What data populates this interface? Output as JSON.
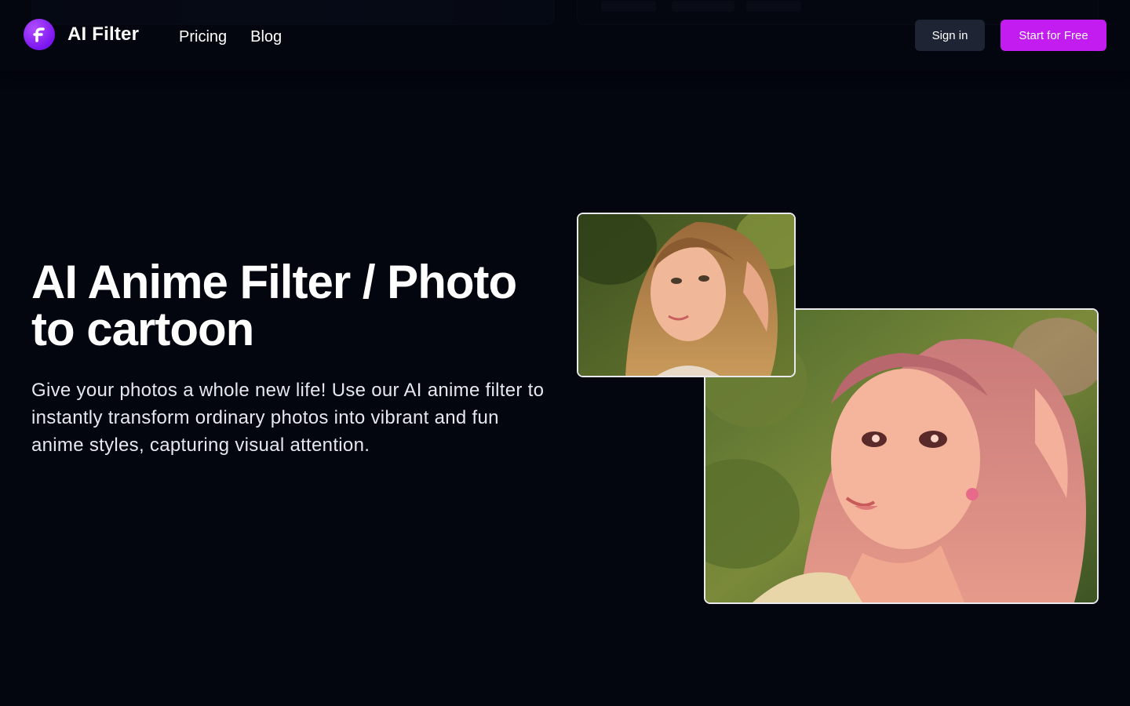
{
  "header": {
    "brand": "AI Filter",
    "nav": [
      {
        "label": "Pricing"
      },
      {
        "label": "Blog"
      }
    ],
    "sign_in_label": "Sign in",
    "start_label": "Start for Free"
  },
  "hero": {
    "title": "AI Anime Filter / Photo to cartoon",
    "description": "Give your photos a whole new life! Use our AI anime filter to instantly transform ordinary photos into vibrant and fun anime styles, capturing visual attention."
  },
  "images": {
    "before_icon": "original-photo-portrait",
    "after_icon": "anime-style-portrait"
  },
  "colors": {
    "background": "#03050f",
    "accent": "#c21cf0",
    "logo": "#8a1ff5",
    "secondary_button": "#1e2433"
  }
}
